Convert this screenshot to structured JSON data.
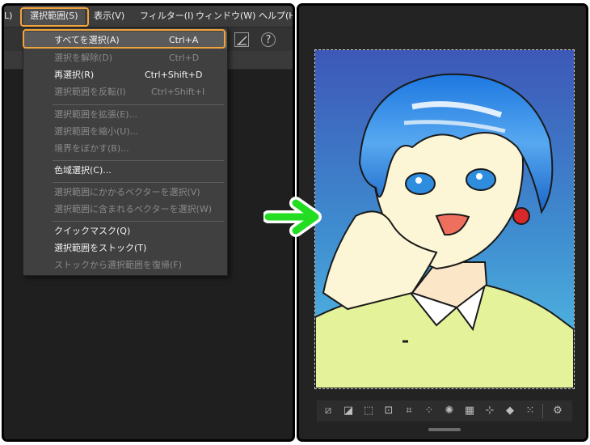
{
  "menubar": {
    "items": [
      {
        "label": "L)"
      },
      {
        "label": "選択範囲(S)"
      },
      {
        "label": "表示(V)"
      },
      {
        "label": "フィルター(I)"
      },
      {
        "label": "ウィンドウ(W)"
      },
      {
        "label": "ヘルプ(H)"
      }
    ]
  },
  "selection_menu": {
    "items": [
      {
        "label": "すべてを選択(A)",
        "shortcut": "Ctrl+A"
      },
      {
        "label": "選択を解除(D)",
        "shortcut": "Ctrl+D"
      },
      {
        "label": "再選択(R)",
        "shortcut": "Ctrl+Shift+D"
      },
      {
        "label": "選択範囲を反転(I)",
        "shortcut": "Ctrl+Shift+I"
      },
      {
        "label": "選択範囲を拡張(E)..."
      },
      {
        "label": "選択範囲を縮小(U)..."
      },
      {
        "label": "境界をぼかす(B)..."
      },
      {
        "label": "色域選択(C)..."
      },
      {
        "label": "選択範囲にかかるベクターを選択(V)"
      },
      {
        "label": "選択範囲に含まれるベクターを選択(W)"
      },
      {
        "label": "クイックマスク(Q)"
      },
      {
        "label": "選択範囲をストック(T)"
      },
      {
        "label": "ストックから選択範囲を復帰(F)"
      }
    ]
  },
  "colors": {
    "highlight": "#f2a33a",
    "arrow": "#22dd22",
    "menu_bg": "#404040",
    "panel_bg": "#1f1f1f"
  },
  "toolbar_icons": [
    "selection-icon",
    "help-icon"
  ],
  "bottom_tools_icons": [
    "deselect-icon",
    "invert-selection-icon",
    "transform-icon",
    "scale-icon",
    "crop-icon",
    "expand-selection-icon",
    "shrink-selection-icon",
    "stock-icon",
    "move-icon",
    "fill-icon",
    "screentone-icon",
    "settings-icon"
  ]
}
